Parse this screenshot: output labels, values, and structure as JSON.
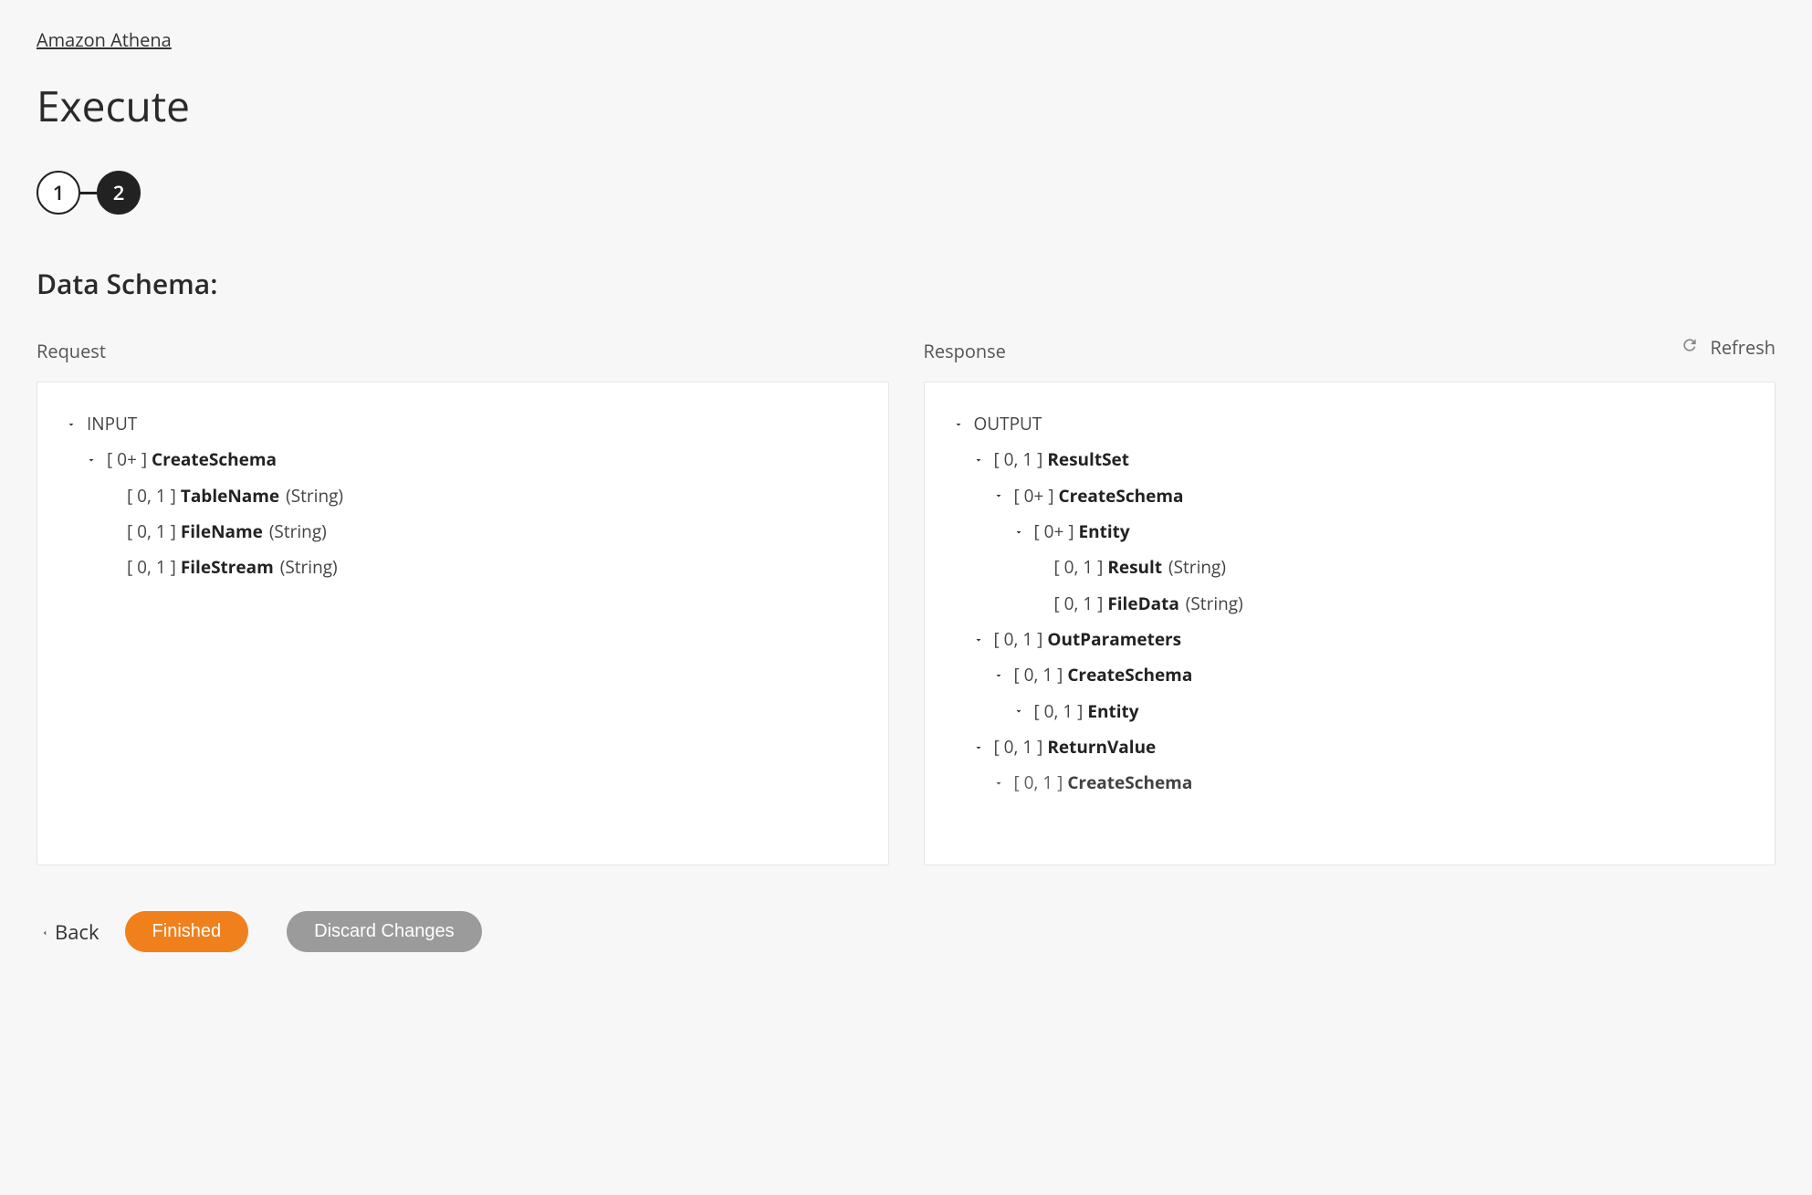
{
  "breadcrumb": "Amazon Athena",
  "page_title": "Execute",
  "stepper": {
    "step1": "1",
    "step2": "2"
  },
  "section_title": "Data Schema:",
  "refresh_label": "Refresh",
  "columns": {
    "request_header": "Request",
    "response_header": "Response"
  },
  "request_tree": {
    "root": "INPUT",
    "n1_card": "[ 0+ ] ",
    "n1_name": "CreateSchema",
    "n2_card": "[ 0, 1 ] ",
    "n2_name": "TableName",
    "n2_type": " (String)",
    "n3_card": "[ 0, 1 ] ",
    "n3_name": "FileName",
    "n3_type": " (String)",
    "n4_card": "[ 0, 1 ] ",
    "n4_name": "FileStream",
    "n4_type": " (String)"
  },
  "response_tree": {
    "root": "OUTPUT",
    "r1_card": "[ 0, 1 ] ",
    "r1_name": "ResultSet",
    "r2_card": "[ 0+ ] ",
    "r2_name": "CreateSchema",
    "r3_card": "[ 0+ ] ",
    "r3_name": "Entity",
    "r4_card": "[ 0, 1 ] ",
    "r4_name": "Result",
    "r4_type": " (String)",
    "r5_card": "[ 0, 1 ] ",
    "r5_name": "FileData",
    "r5_type": " (String)",
    "r6_card": "[ 0, 1 ] ",
    "r6_name": "OutParameters",
    "r7_card": "[ 0, 1 ] ",
    "r7_name": "CreateSchema",
    "r8_card": "[ 0, 1 ] ",
    "r8_name": "Entity",
    "r9_card": "[ 0, 1 ] ",
    "r9_name": "ReturnValue",
    "r10_card": "[ 0, 1 ] ",
    "r10_name": "CreateSchema"
  },
  "footer": {
    "back": "Back",
    "finished": "Finished",
    "discard": "Discard Changes"
  }
}
